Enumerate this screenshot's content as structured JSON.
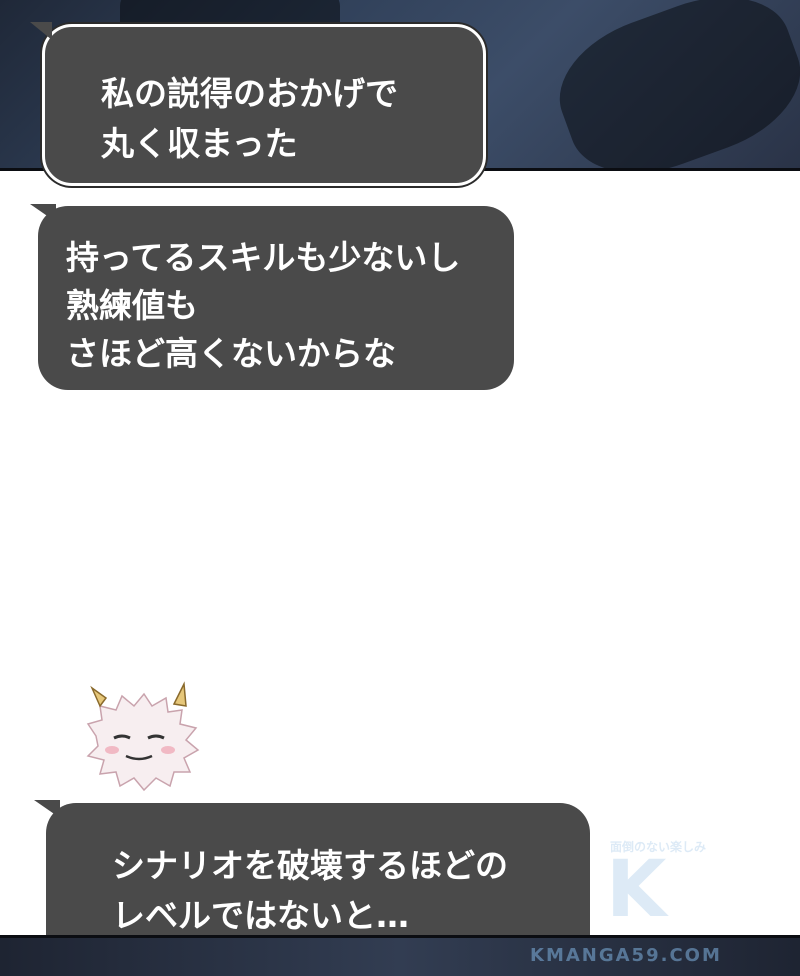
{
  "bubbles": {
    "top": {
      "lines": [
        "私の説得のおかげで",
        "丸く収まった"
      ]
    },
    "middle": {
      "lines": [
        "持ってるスキルも少ないし",
        "熟練値も",
        "さほど高くないからな"
      ]
    },
    "bottom": {
      "lines": [
        "シナリオを破壊するほどの",
        "レベルではないと…"
      ]
    }
  },
  "watermark": {
    "tagline": "面倒のない楽しみ",
    "logo": "K",
    "url": "KMANGA59.COM"
  },
  "colors": {
    "bubble_fill": "#4a4a4a",
    "bubble_text": "#ffffff",
    "panel_dark": "#2a3347"
  }
}
